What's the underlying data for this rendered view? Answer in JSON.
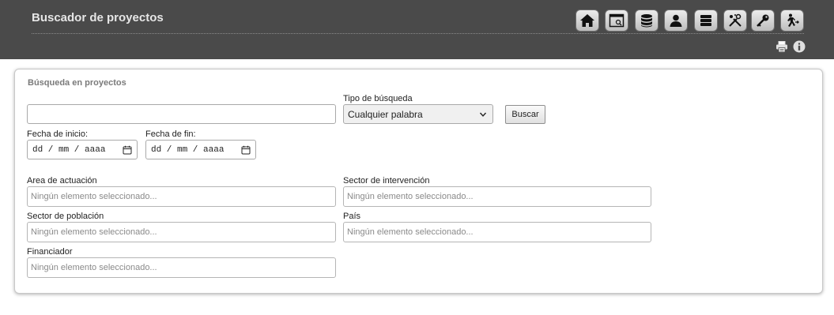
{
  "header": {
    "title": "Buscador de proyectos",
    "toolbar": [
      {
        "icon": "home-icon"
      },
      {
        "icon": "window-search-icon"
      },
      {
        "icon": "database-icon"
      },
      {
        "icon": "user-icon"
      },
      {
        "icon": "books-icon"
      },
      {
        "icon": "tools-icon"
      },
      {
        "icon": "key-icon"
      },
      {
        "icon": "exit-icon"
      }
    ],
    "utilities": [
      {
        "icon": "print-icon"
      },
      {
        "icon": "info-icon"
      }
    ]
  },
  "panel": {
    "title": "Búsqueda en proyectos",
    "search": {
      "value": "",
      "placeholder": ""
    },
    "search_type": {
      "label": "Tipo de búsqueda",
      "selected": "Cualquier palabra"
    },
    "search_button": "Buscar",
    "start_date": {
      "label": "Fecha de inicio:",
      "placeholder": "dd / mm / aaaa"
    },
    "end_date": {
      "label": "Fecha de fin:",
      "placeholder": "dd / mm / aaaa"
    },
    "filters": {
      "area": {
        "label": "Area de actuación",
        "placeholder": "Ningún elemento seleccionado..."
      },
      "sector_intervencion": {
        "label": "Sector de intervención",
        "placeholder": "Ningún elemento seleccionado..."
      },
      "sector_poblacion": {
        "label": "Sector de población",
        "placeholder": "Ningún elemento seleccionado..."
      },
      "pais": {
        "label": "País",
        "placeholder": "Ningún elemento seleccionado..."
      },
      "financiador": {
        "label": "Financiador",
        "placeholder": "Ningún elemento seleccionado..."
      }
    }
  },
  "colors": {
    "header_bg": "#4a4a4a",
    "header_text": "#e6e6e6",
    "panel_border": "#c8c8c8",
    "placeholder_text": "#8a8a8a"
  }
}
